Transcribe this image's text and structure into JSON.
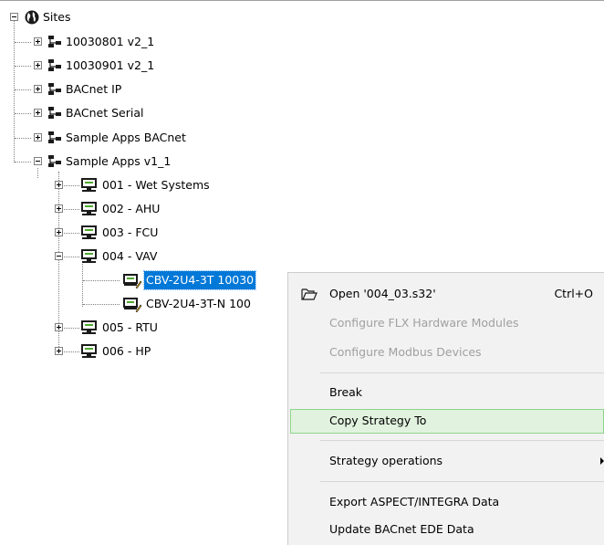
{
  "tree": {
    "root": {
      "label": "Sites",
      "icon": "globe-icon",
      "expanded": true
    },
    "sites": [
      {
        "label": "10030801 v2_1",
        "icon": "network-icon",
        "expanded": false
      },
      {
        "label": "10030901 v2_1",
        "icon": "network-icon",
        "expanded": false
      },
      {
        "label": "BACnet IP",
        "icon": "network-icon",
        "expanded": false
      },
      {
        "label": "BACnet Serial",
        "icon": "network-icon",
        "expanded": false
      },
      {
        "label": "Sample Apps BACnet",
        "icon": "network-icon",
        "expanded": false
      },
      {
        "label": "Sample Apps v1_1",
        "icon": "network-icon",
        "expanded": true
      }
    ],
    "devices": [
      {
        "label": "001 - Wet Systems",
        "icon": "controller-icon",
        "expanded": false
      },
      {
        "label": "002 - AHU",
        "icon": "controller-icon",
        "expanded": false
      },
      {
        "label": "003 - FCU",
        "icon": "controller-icon",
        "expanded": false
      },
      {
        "label": "004 - VAV",
        "icon": "controller-icon",
        "expanded": true
      },
      {
        "label": "005 - RTU",
        "icon": "controller-icon",
        "expanded": false
      },
      {
        "label": "006 - HP",
        "icon": "controller-icon",
        "expanded": false
      }
    ],
    "strategies": [
      {
        "label": "CBV-2U4-3T 10030",
        "icon": "strategy-edit-icon",
        "selected": true
      },
      {
        "label": "CBV-2U4-3T-N 100",
        "icon": "strategy-edit-icon",
        "selected": false
      }
    ]
  },
  "context_menu": {
    "open": {
      "label": "Open '004_03.s32'",
      "shortcut": "Ctrl+O",
      "icon": "open-folder-icon"
    },
    "configure_flx": {
      "label": "Configure FLX Hardware Modules",
      "enabled": false
    },
    "configure_modbus": {
      "label": "Configure Modbus Devices",
      "enabled": false
    },
    "break": {
      "label": "Break"
    },
    "copy_strategy": {
      "label": "Copy Strategy To",
      "highlighted": true
    },
    "strategy_operations": {
      "label": "Strategy operations",
      "has_submenu": true
    },
    "export_aspect": {
      "label": "Export ASPECT/INTEGRA Data"
    },
    "update_bacnet": {
      "label": "Update BACnet EDE Data"
    }
  },
  "colors": {
    "selection": "#0078d7",
    "menu_bg": "#f2f2f2",
    "menu_hover": "#e1f2df",
    "menu_hover_border": "#8ed58b",
    "disabled_text": "#a0a0a0"
  }
}
